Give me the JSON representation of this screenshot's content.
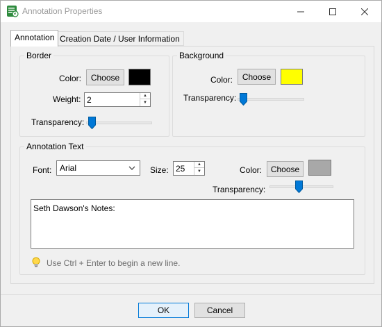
{
  "window": {
    "title": "Annotation Properties",
    "icon": "annotation-app-icon"
  },
  "tabs": [
    {
      "label": "Annotation",
      "active": true
    },
    {
      "label": "Creation Date / User Information",
      "active": false
    }
  ],
  "border": {
    "group_title": "Border",
    "color_label": "Color:",
    "choose_label": "Choose",
    "color": "#000000",
    "weight_label": "Weight:",
    "weight_value": "2",
    "transparency_label": "Transparency:",
    "transparency_level": 0.05
  },
  "background": {
    "group_title": "Background",
    "color_label": "Color:",
    "choose_label": "Choose",
    "color": "#ffff00",
    "transparency_label": "Transparency:",
    "transparency_level": 0.05
  },
  "annotation_text": {
    "group_title": "Annotation Text",
    "font_label": "Font:",
    "font_value": "Arial",
    "size_label": "Size:",
    "size_value": "25",
    "color_label": "Color:",
    "choose_label": "Choose",
    "color": "#a8a8a8",
    "transparency_label": "Transparency:",
    "transparency_level": 0.45,
    "text_value": "Seth Dawson's Notes:",
    "hint": "Use Ctrl + Enter to begin a new line.",
    "hint_icon": "lightbulb-icon"
  },
  "footer": {
    "ok_label": "OK",
    "cancel_label": "Cancel"
  },
  "colors": {
    "accent": "#0078d7",
    "dialog_bg": "#f0f0f0"
  }
}
